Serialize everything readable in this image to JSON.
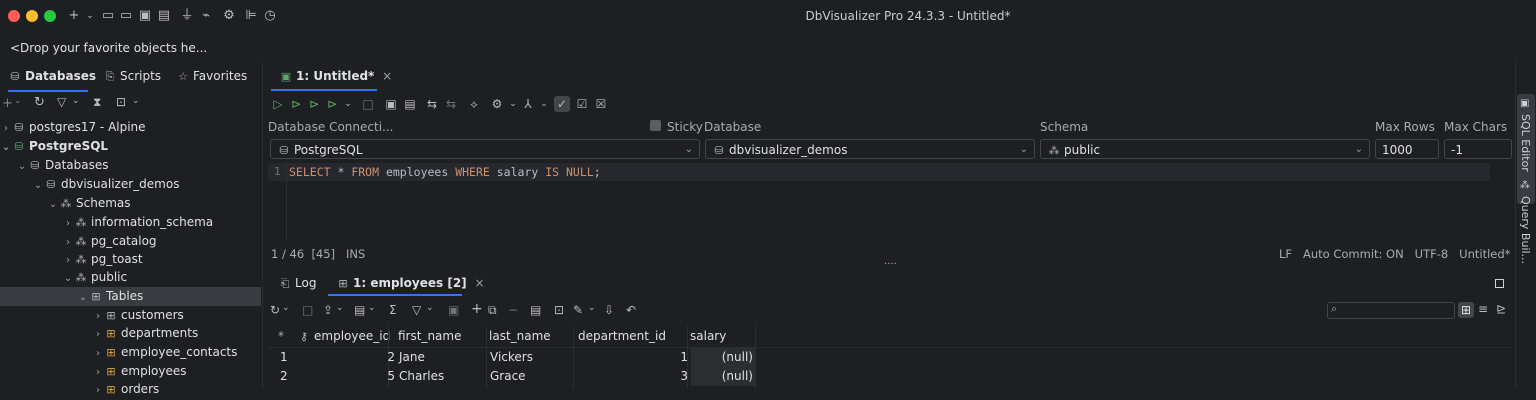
{
  "window": {
    "title": "DbVisualizer Pro 24.3.3 - Untitled*"
  },
  "favorites_bar": {
    "placeholder": "<Drop your favorite objects he..."
  },
  "sidebar": {
    "tabs": [
      {
        "label": "Databases",
        "icon": "cylinder-icon"
      },
      {
        "label": "Scripts",
        "icon": "script-icon"
      },
      {
        "label": "Favorites",
        "icon": "star-icon"
      }
    ],
    "tree": [
      {
        "label": "postgres17 - Alpine",
        "bold": false
      },
      {
        "label": "PostgreSQL",
        "bold": true
      },
      {
        "label": "Databases"
      },
      {
        "label": "dbvisualizer_demos"
      },
      {
        "label": "Schemas"
      },
      {
        "label": "information_schema"
      },
      {
        "label": "pg_catalog"
      },
      {
        "label": "pg_toast"
      },
      {
        "label": "public"
      },
      {
        "label": "Tables"
      },
      {
        "label": "customers"
      },
      {
        "label": "departments"
      },
      {
        "label": "employee_contacts"
      },
      {
        "label": "employees"
      },
      {
        "label": "orders"
      }
    ]
  },
  "editor": {
    "tab_label": "1: Untitled*",
    "labels": {
      "connection": "Database Connecti...",
      "sticky": "Sticky",
      "database": "Database",
      "schema": "Schema",
      "max_rows": "Max Rows",
      "max_chars": "Max Chars"
    },
    "connection_value": "PostgreSQL",
    "database_value": "dbvisualizer_demos",
    "schema_value": "public",
    "max_rows_value": "1000",
    "max_chars_value": "-1",
    "line_number": "1",
    "sql": {
      "t1": "SELECT",
      "t2": " * ",
      "t3": "FROM",
      "t4": " employees ",
      "t5": "WHERE",
      "t6": " salary ",
      "t7": "IS NULL",
      "t8": ";"
    },
    "status_left": "1 / 46  [45]   INS",
    "status_right": "LF   Auto Commit: ON   UTF-8   Untitled*",
    "splitter": "...."
  },
  "results": {
    "tabs": [
      {
        "label": "Log"
      },
      {
        "label": "1: employees [2]"
      }
    ],
    "search_placeholder": "",
    "columns": [
      "employee_id",
      "first_name",
      "last_name",
      "department_id",
      "salary"
    ],
    "rows": [
      {
        "num": "1",
        "employee_id": "2",
        "first_name": "Jane",
        "last_name": "Vickers",
        "department_id": "1",
        "salary": "(null)"
      },
      {
        "num": "2",
        "employee_id": "5",
        "first_name": "Charles",
        "last_name": "Grace",
        "department_id": "3",
        "salary": "(null)"
      }
    ],
    "row_marker": "*"
  },
  "right_panel": {
    "sql_editor": "SQL Editor",
    "query_builder": "Query Buil..."
  },
  "colors": {
    "accent": "#3574f0",
    "traffic_red": "#ff5f57",
    "traffic_yellow": "#febc2e",
    "traffic_green": "#28c840"
  }
}
